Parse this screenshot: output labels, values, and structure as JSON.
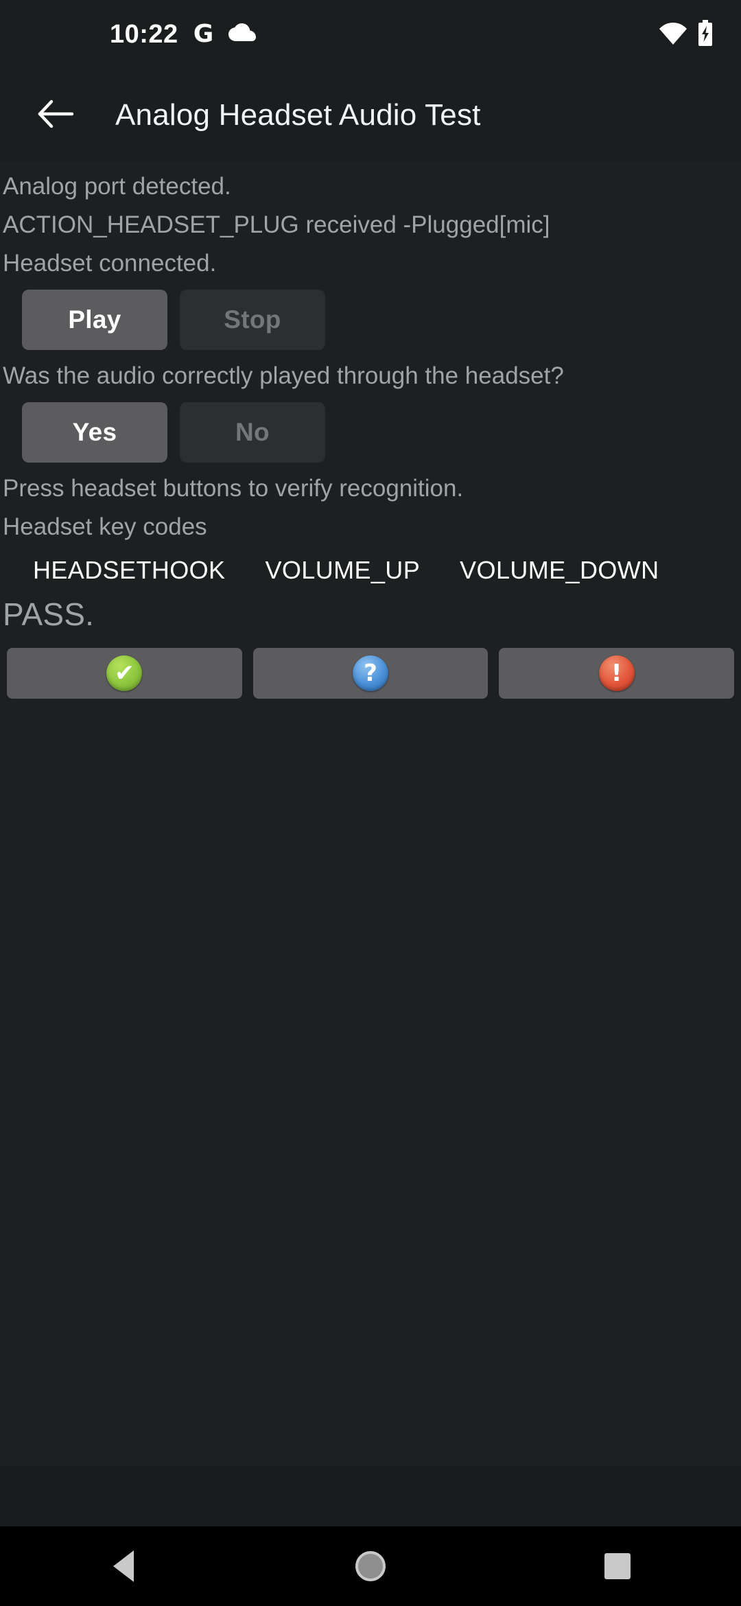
{
  "status_bar": {
    "time": "10:22",
    "google_icon": "google-g-icon",
    "cloud_icon": "cloud-icon",
    "wifi_icon": "wifi-icon",
    "battery_icon": "battery-charging-icon"
  },
  "app_bar": {
    "back_icon": "back-arrow-icon",
    "title": "Analog Headset Audio Test"
  },
  "main": {
    "status_lines": [
      "Analog port detected.",
      "ACTION_HEADSET_PLUG received -Plugged[mic]",
      "Headset connected."
    ],
    "playback_buttons": [
      {
        "label": "Play",
        "enabled": true
      },
      {
        "label": "Stop",
        "enabled": false
      }
    ],
    "question": "Was the audio correctly played through the headset?",
    "answer_buttons": [
      {
        "label": "Yes",
        "enabled": true
      },
      {
        "label": "No",
        "enabled": false
      }
    ],
    "keycode_instruction": "Press headset buttons to verify recognition.",
    "keycode_heading": "Headset key codes",
    "keycodes": [
      "HEADSETHOOK",
      "VOLUME_UP",
      "VOLUME_DOWN"
    ],
    "verdict": "PASS."
  },
  "action_bar": {
    "buttons": [
      {
        "name": "pass-button",
        "icon": "check-circle-icon",
        "glyph": "✔",
        "color": "#8cc63f"
      },
      {
        "name": "info-button",
        "icon": "question-circle-icon",
        "glyph": "?",
        "color": "#4a90d9"
      },
      {
        "name": "fail-button",
        "icon": "exclamation-circle-icon",
        "glyph": "!",
        "color": "#e2553a"
      }
    ]
  },
  "nav_bar": {
    "back": "nav-back-icon",
    "home": "nav-home-icon",
    "recents": "nav-recents-icon"
  }
}
